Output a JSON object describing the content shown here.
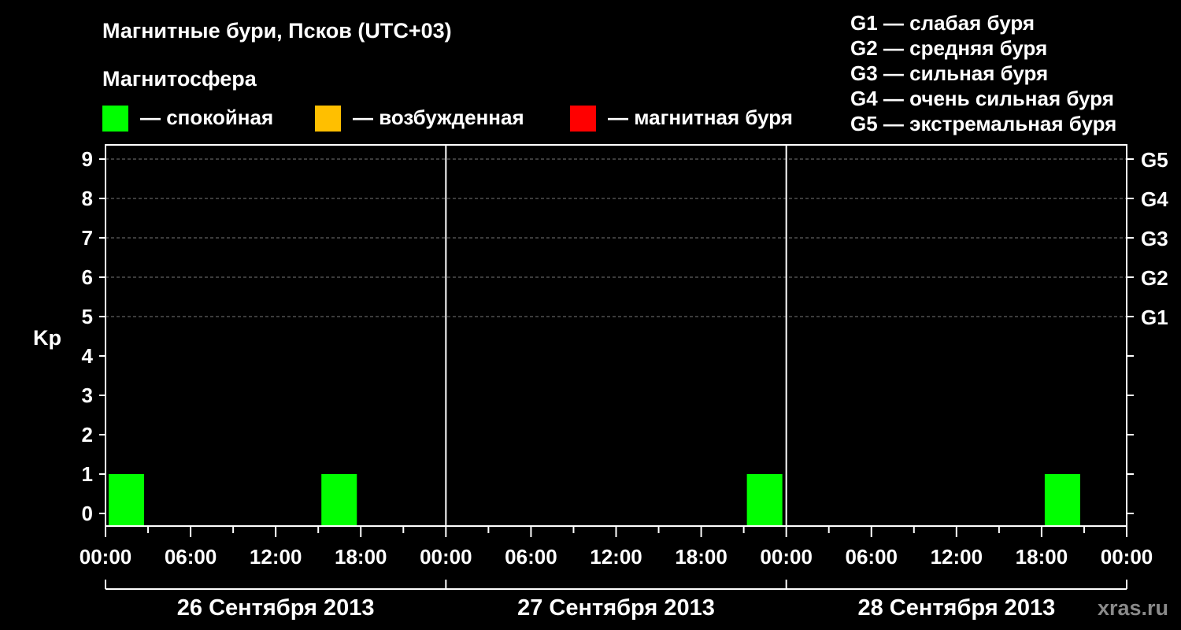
{
  "chart_data": {
    "type": "bar",
    "title": "Магнитные бури, Псков (UTC+03)",
    "subtitle": "Магнитосфера",
    "ylabel": "Kp",
    "ylim": [
      0,
      9
    ],
    "yticks": [
      "0",
      "1",
      "2",
      "3",
      "4",
      "5",
      "6",
      "7",
      "8",
      "9"
    ],
    "right_axis_labels": [
      {
        "kp": 5,
        "label": "G1"
      },
      {
        "kp": 6,
        "label": "G2"
      },
      {
        "kp": 7,
        "label": "G3"
      },
      {
        "kp": 8,
        "label": "G4"
      },
      {
        "kp": 9,
        "label": "G5"
      }
    ],
    "x_tick_labels": [
      "00:00",
      "06:00",
      "12:00",
      "18:00",
      "00:00",
      "06:00",
      "12:00",
      "18:00",
      "00:00",
      "06:00",
      "12:00",
      "18:00",
      "00:00"
    ],
    "days": [
      "26 Сентября 2013",
      "27 Сентября 2013",
      "28 Сентября 2013"
    ],
    "legend": [
      {
        "label": "— спокойная",
        "color": "#00ff00"
      },
      {
        "label": "— возбужденная",
        "color": "#ffbf00"
      },
      {
        "label": "— магнитная буря",
        "color": "#ff0000"
      }
    ],
    "storm_scale": [
      "G1 — слабая буря",
      "G2 — средняя буря",
      "G3 — сильная буря",
      "G4 — очень сильная буря",
      "G5 — экстремальная буря"
    ],
    "bars": [
      {
        "day": 0,
        "start_hour": 0,
        "kp": 1,
        "color": "#00ff00"
      },
      {
        "day": 0,
        "start_hour": 15,
        "kp": 1,
        "color": "#00ff00"
      },
      {
        "day": 1,
        "start_hour": 21,
        "kp": 1,
        "color": "#00ff00"
      },
      {
        "day": 2,
        "start_hour": 18,
        "kp": 1,
        "color": "#00ff00"
      }
    ],
    "gridlines_at_kp": [
      5,
      6,
      7,
      8,
      9
    ],
    "watermark": "xras.ru"
  }
}
